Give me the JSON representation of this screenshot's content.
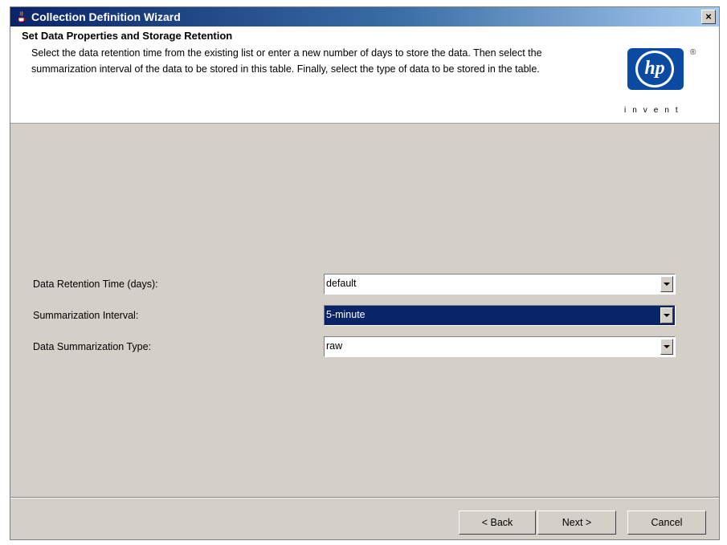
{
  "window": {
    "title": "Collection Definition Wizard",
    "close_label": "×"
  },
  "header": {
    "title": "Set Data Properties and Storage Retention",
    "description": "Select the data retention time from the existing list or enter a new number of days to store the data. Then select the summarization interval of the data to be stored in this table. Finally, select the type of data to be stored in the table.",
    "logo_text": "hp",
    "logo_tagline": "invent",
    "logo_reg_mark": "®"
  },
  "form": {
    "fields": [
      {
        "label": "Data Retention Time (days):",
        "value": "default",
        "selected": false
      },
      {
        "label": "Summarization Interval:",
        "value": "5-minute",
        "selected": true
      },
      {
        "label": "Data Summarization Type:",
        "value": "raw",
        "selected": false
      }
    ]
  },
  "buttons": {
    "back": "< Back",
    "next": "Next >",
    "cancel": "Cancel"
  },
  "colors": {
    "title_bar": "#0a246a",
    "selection": "#0a246a",
    "hp_blue": "#0b4aa2",
    "dialog_bg": "#d4d0c8"
  }
}
